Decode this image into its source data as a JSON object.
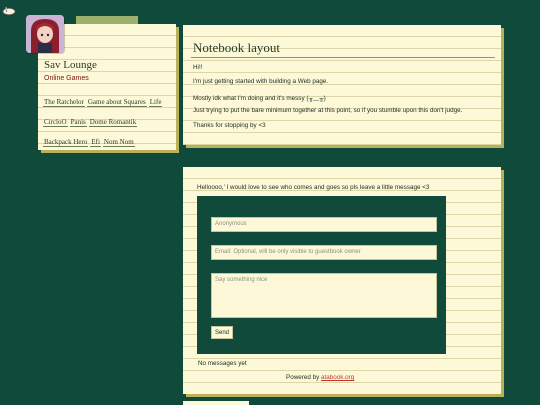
{
  "sidebar": {
    "site_title": "Sav Lounge",
    "section_label": "Online Games",
    "links": [
      "The Ratchelor",
      "Game about Squares",
      "Life",
      "CircloO",
      "Panis",
      "Dome Romantik",
      "Backpack Hero",
      "Efi",
      "Nom Nom"
    ]
  },
  "main": {
    "title": "Notebook layout",
    "paragraphs": [
      "Hi!!",
      "I'm just getting started with building a Web page.",
      "Mostly idk what I'm doing and it's messy (╥﹏╥)",
      "Just trying to put the bare minimum together at this point, so if you stumble upon this don't judge.",
      "Thanks for stopping by <3"
    ]
  },
  "guestbook": {
    "greeting": "Helloooo,' I would love to see who comes and goes so pls leave a little message <3",
    "name_placeholder": "Anonymous",
    "email_placeholder": "Email: Optional, will be only visible to guestbook owner",
    "message_placeholder": "Say something nice",
    "send_label": "Send",
    "no_messages": "No messages yet",
    "powered_prefix": "Powered by",
    "powered_link": "atabook.org"
  },
  "colors": {
    "page_bg": "#0f4a3a",
    "paper": "#fdf9d8",
    "link_red": "#c0392b"
  },
  "icons": {
    "corner": "cat-icon"
  }
}
